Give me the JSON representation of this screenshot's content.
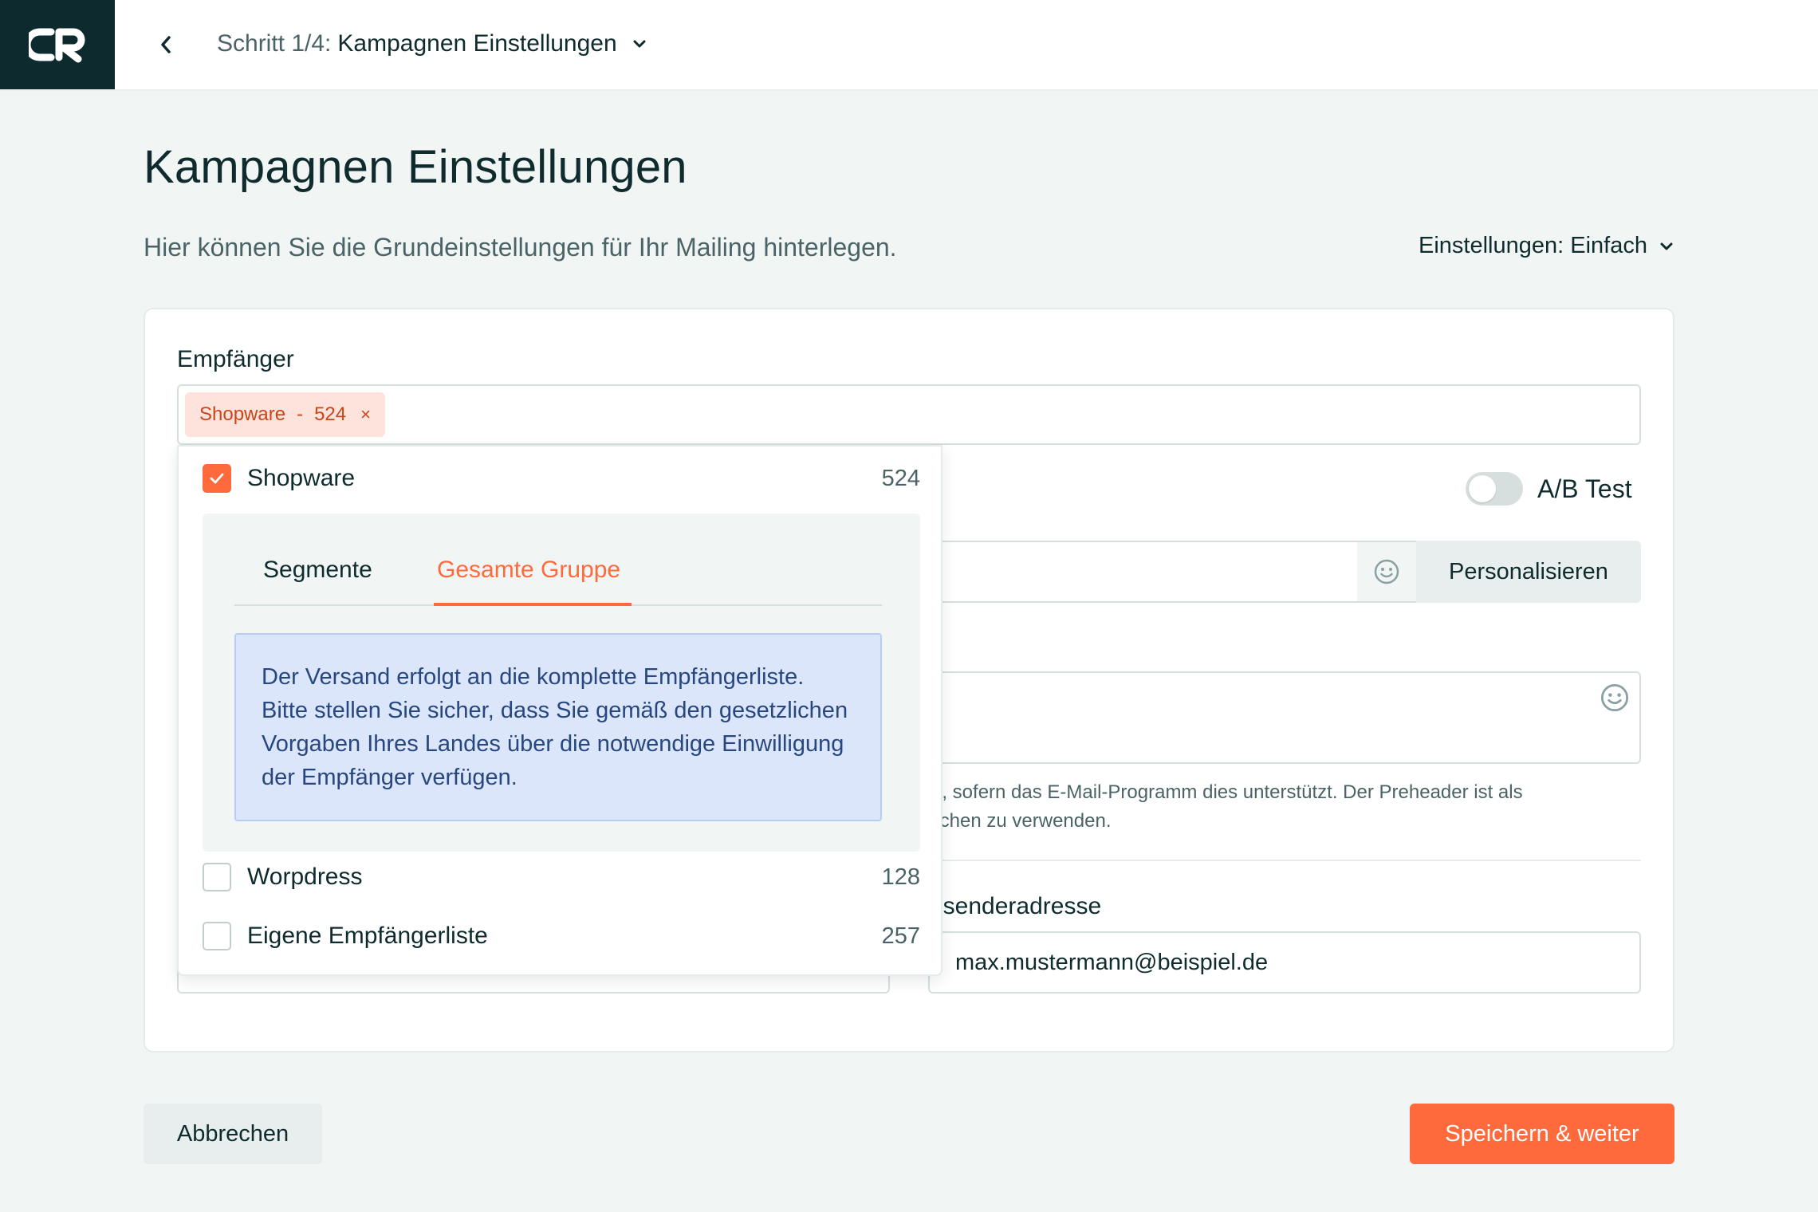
{
  "topbar": {
    "logo_icon": "brand-logo-icon",
    "back_icon": "chevron-left-icon",
    "step_label": "Schritt 1/4:",
    "current_step": "Kampagnen Einstellungen",
    "step_menu_icon": "chevron-down-icon"
  },
  "page": {
    "title": "Kampagnen Einstellungen",
    "subtitle": "Hier können Sie die Grundeinstellungen für Ihr Mailing hinterlegen.",
    "settings_mode": "Einstellungen: Einfach"
  },
  "recipients": {
    "label": "Empfänger",
    "chip": {
      "name": "Shopware",
      "separator": "-",
      "count": "524",
      "remove": "×"
    }
  },
  "dropdown": {
    "options": [
      {
        "name": "Shopware",
        "count": "524",
        "checked": true
      },
      {
        "name": "Worpdress",
        "count": "128",
        "checked": false
      },
      {
        "name": "Eigene Empfängerliste",
        "count": "257",
        "checked": false
      }
    ],
    "tabs": [
      "Segmente",
      "Gesamte Gruppe"
    ],
    "active_tab": "Gesamte Gruppe",
    "info_text": "Der Versand erfolgt an die komplette Empfängerliste. Bitte stellen Sie sicher, dass Sie gemäß den gesetzlichen Vorgaben Ihres Landes über die notwendige Einwilligung der Empfänger verfügen."
  },
  "form": {
    "ab_test_label": "A/B Test",
    "ab_test_enabled": false,
    "personalize_label": "Personalisieren",
    "preheader_hint": "rd, sofern das E-Mail-Programm dies unterstützt. Der Preheader ist als\neichen zu verwenden.",
    "sender_label": "bsenderadresse",
    "sender_value": "max.mustermann@beispiel.de"
  },
  "footer": {
    "cancel_label": "Abbrechen",
    "save_label": "Speichern & weiter"
  },
  "colors": {
    "brand_dark": "#0d2b2f",
    "accent": "#ff6a3d",
    "info_bg": "#dbe6fb",
    "info_text": "#27477e"
  }
}
